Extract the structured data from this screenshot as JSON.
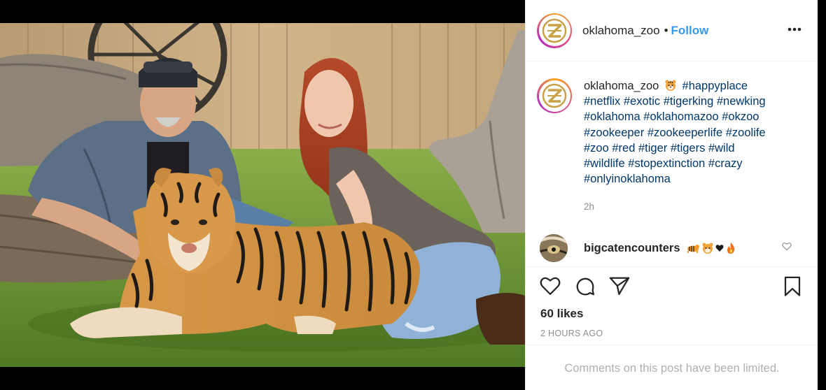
{
  "post": {
    "username": "oklahoma_zoo",
    "follow_label": "Follow",
    "caption_emoji": "tiger-face-emoji",
    "caption_hashtags": "#happyplace #netflix #exotic #tigerking #newking #oklahoma #oklahomazoo #okzoo #zookeeper #zookeeperlife #zoolife #zoo #red #tiger #tigers #wild #wildlife #stopextinction #crazy #onlyinoklahoma",
    "caption_lines": [
      "#happyplace",
      "#netflix #exotic #tigerking #newking",
      "#oklahoma #oklahomazoo #okzoo",
      "#zookeeper #zookeeperlife #zoolife",
      "#zoo #red #tiger #tigers #wild",
      "#wildlife #stopextinction #crazy",
      "#onlyinoklahoma"
    ],
    "caption_time": "2h",
    "likes_text": "60 likes",
    "posted_ago": "2 HOURS AGO",
    "comments_limited": "Comments on this post have been limited."
  },
  "comment": {
    "username": "bigcatencounters",
    "emojis": [
      "tiger-emoji",
      "tiger-face-emoji",
      "black-heart-emoji",
      "fire-emoji"
    ]
  },
  "icons": {
    "more": "more-options-icon",
    "like": "heart-outline-icon",
    "comment": "comment-bubble-icon",
    "share": "paper-plane-icon",
    "save": "bookmark-icon",
    "comment_like": "small-heart-icon"
  },
  "colors": {
    "follow_blue": "#3897f0",
    "hashtag_blue": "#00376b",
    "muted_gray": "#8e8e8e"
  }
}
